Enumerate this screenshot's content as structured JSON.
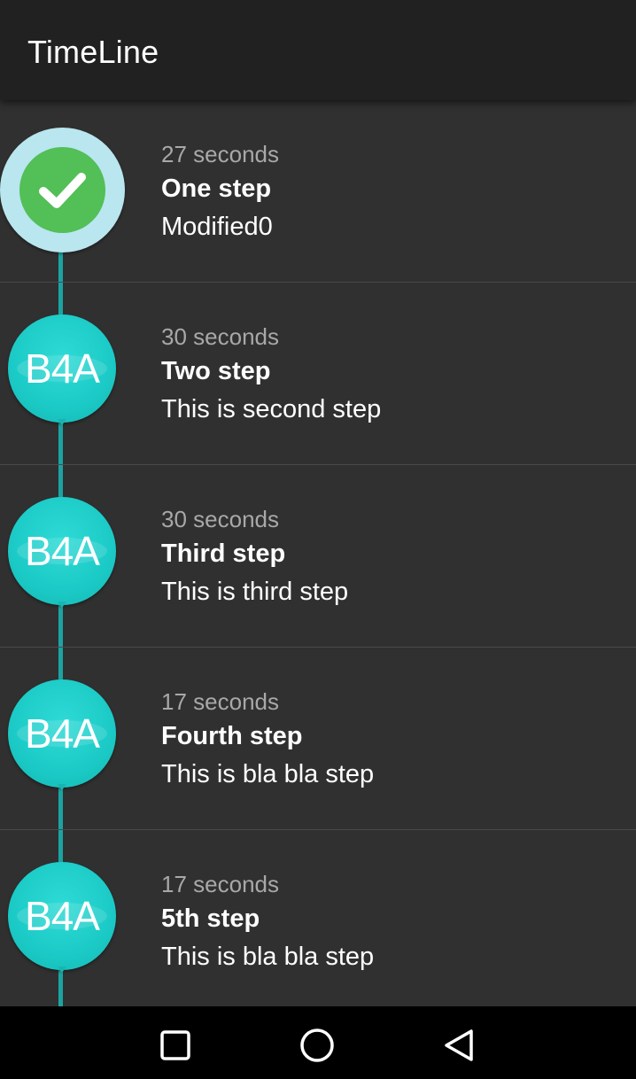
{
  "app": {
    "title": "TimeLine"
  },
  "timeline": {
    "items": [
      {
        "time": "27 seconds",
        "step": "One step",
        "description": "Modified0",
        "icon": "check-icon",
        "completed": true
      },
      {
        "time": "30 seconds",
        "step": "Two step",
        "description": "This is second step",
        "badge": "B4A",
        "completed": false
      },
      {
        "time": "30 seconds",
        "step": "Third step",
        "description": "This is third step",
        "badge": "B4A",
        "completed": false
      },
      {
        "time": "17 seconds",
        "step": "Fourth step",
        "description": "This is bla bla step",
        "badge": "B4A",
        "completed": false
      },
      {
        "time": "17 seconds",
        "step": "5th step",
        "description": "This is bla bla step",
        "badge": "B4A",
        "completed": false
      }
    ]
  },
  "colors": {
    "background": "#303030",
    "appbar": "#212121",
    "accent": "#1bcac6",
    "check": "#52bf57"
  },
  "navbar": {
    "buttons": [
      "recents-icon",
      "home-icon",
      "back-icon"
    ]
  }
}
